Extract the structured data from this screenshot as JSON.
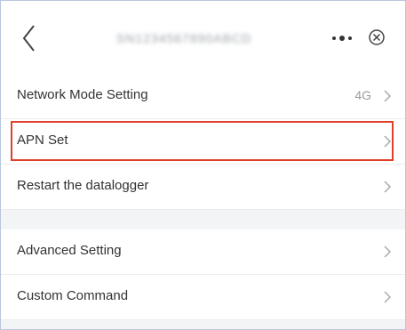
{
  "header": {
    "title": "SN1234567890ABCD",
    "back_icon": "chevron-left-icon",
    "more_icon": "more-dots-icon",
    "close_icon": "close-circle-icon"
  },
  "settings": {
    "items": [
      {
        "label": "Network Mode Setting",
        "value": "4G"
      },
      {
        "label": "APN Set",
        "value": ""
      },
      {
        "label": "Restart the datalogger",
        "value": ""
      },
      {
        "label": "Advanced Setting",
        "value": ""
      },
      {
        "label": "Custom Command",
        "value": ""
      }
    ],
    "highlighted_item": "APN Set"
  },
  "colors": {
    "highlight": "#e0402b",
    "background": "#f3f4f6",
    "text": "#333333",
    "secondary_text": "#9a9a9a"
  }
}
